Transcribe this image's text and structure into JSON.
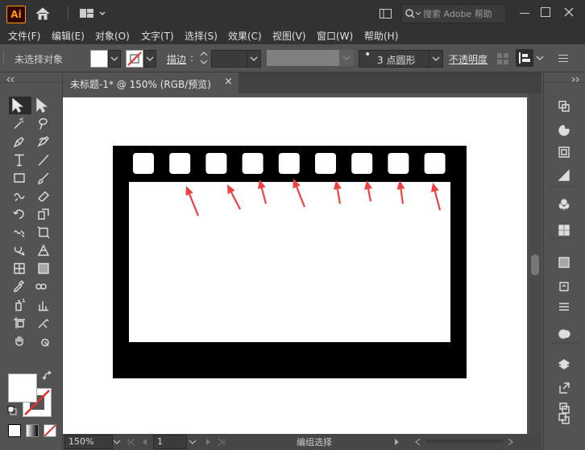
{
  "app": {
    "logo": "Ai"
  },
  "search": {
    "placeholder": "搜索 Adobe 帮助"
  },
  "menu": [
    "文件(F)",
    "编辑(E)",
    "对象(O)",
    "文字(T)",
    "选择(S)",
    "效果(C)",
    "视图(V)",
    "窗口(W)",
    "帮助(H)"
  ],
  "control": {
    "selection_label": "未选择对象",
    "stroke_label": "描边",
    "stroke_colon": ":",
    "brush_label": "3 点圆形",
    "opacity_label": "不透明度"
  },
  "document": {
    "tab_title": "未标题-1* @ 150% (RGB/预览)",
    "close": "×"
  },
  "status": {
    "zoom": "150%",
    "artboard": "1",
    "tool_status": "编组选择"
  },
  "artwork": {
    "sprocket_holes": 9,
    "arrows": 8,
    "film_color": "#000000",
    "arrow_color": "#f04040"
  },
  "colors": {
    "dark_bar": "#323232",
    "panel": "#535353",
    "accent_red": "#e03030"
  },
  "icons": {
    "left_tools": [
      "selection-icon",
      "direct-selection-icon",
      "magic-wand-icon",
      "lasso-icon",
      "pen-icon",
      "curvature-icon",
      "type-icon",
      "line-icon",
      "rectangle-icon",
      "paintbrush-icon",
      "shaper-icon",
      "eraser-icon",
      "rotate-icon",
      "scale-icon",
      "warp-icon",
      "free-transform-icon",
      "shape-builder-icon",
      "perspective-icon",
      "mesh-icon",
      "gradient-icon",
      "eyedropper-icon",
      "blend-icon",
      "symbol-sprayer-icon",
      "column-graph-icon",
      "artboard-icon",
      "slice-icon",
      "hand-icon",
      "zoom-icon"
    ],
    "right_panels": [
      "transform-panel-icon",
      "color-panel-icon",
      "swatches-panel-icon",
      "color-guide-icon",
      "symbols-icon",
      "graphic-styles-icon",
      "gradient-panel-icon",
      "export-icon",
      "align-icon",
      "appearance-icon",
      "layers-icon",
      "asset-export-icon",
      "artboards-icon",
      "links-icon"
    ]
  }
}
